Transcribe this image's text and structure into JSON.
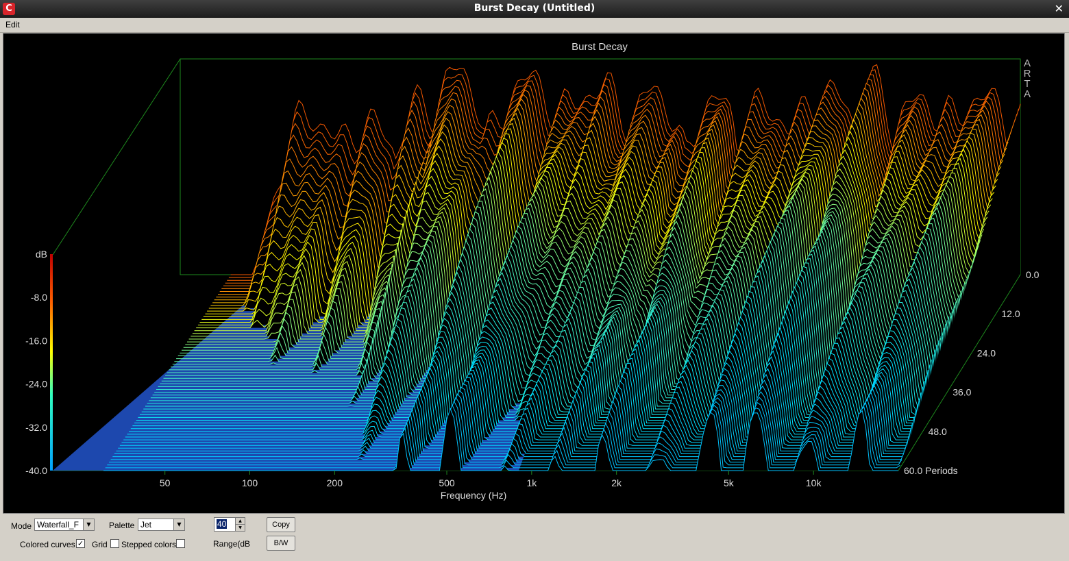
{
  "window": {
    "title": "Burst Decay  (Untitled)",
    "icon": "arta-app-icon",
    "close_glyph": "✕"
  },
  "menu": {
    "items": [
      {
        "label": "Edit"
      }
    ]
  },
  "plot": {
    "watermark": [
      "A",
      "R",
      "T",
      "A"
    ],
    "palette_colors": [
      "#00008f",
      "#0000ff",
      "#00ffff",
      "#ffff00",
      "#ff0000",
      "#800000"
    ],
    "chart_data": {
      "type": "waterfall",
      "title": "Burst Decay",
      "xlabel": "Frequency (Hz)",
      "zlabel": "dB",
      "x_scale": "log",
      "x_ticks": [
        "50",
        "100",
        "200",
        "500",
        "1k",
        "2k",
        "5k",
        "10k"
      ],
      "x_tick_values": [
        50,
        100,
        200,
        500,
        1000,
        2000,
        5000,
        10000
      ],
      "xlim": [
        20,
        20000
      ],
      "z_ticks": [
        "-8.0",
        "-16.0",
        "-24.0",
        "-32.0",
        "-40.0"
      ],
      "z_tick_values": [
        -8,
        -16,
        -24,
        -32,
        -40
      ],
      "zlim": [
        -40,
        0
      ],
      "y_ticks": [
        "0.0",
        "12.0",
        "24.0",
        "36.0",
        "48.0",
        "60.0 Periods"
      ],
      "y_tick_values": [
        0,
        12,
        24,
        36,
        48,
        60
      ],
      "ylim": [
        0,
        60
      ],
      "front_slice_peaks_db": [
        {
          "freq": 60,
          "db": -10
        },
        {
          "freq": 90,
          "db": -12
        },
        {
          "freq": 150,
          "db": -8
        },
        {
          "freq": 200,
          "db": -1
        },
        {
          "freq": 350,
          "db": -4
        },
        {
          "freq": 600,
          "db": -5
        },
        {
          "freq": 1000,
          "db": -5
        },
        {
          "freq": 1600,
          "db": -7
        },
        {
          "freq": 2500,
          "db": -9
        },
        {
          "freq": 4000,
          "db": -6
        },
        {
          "freq": 6000,
          "db": -5
        },
        {
          "freq": 9000,
          "db": -7
        },
        {
          "freq": 14000,
          "db": -7
        },
        {
          "freq": 20000,
          "db": -12
        }
      ]
    }
  },
  "controls": {
    "mode_label": "Mode",
    "mode_value": "Waterfall_F",
    "palette_label": "Palette",
    "palette_value": "Jet",
    "range_value": "40",
    "range_label": "Range(dB",
    "copy_button": "Copy",
    "bw_button": "B/W",
    "colored_curves_label": "Colored curves",
    "colored_curves_checked": true,
    "grid_label": "Grid",
    "grid_checked": false,
    "stepped_colors_label": "Stepped colors",
    "stepped_colors_checked": false,
    "check_glyph": "✓",
    "arrow_glyph": "▼",
    "spin_up_glyph": "▲",
    "spin_down_glyph": "▼"
  }
}
